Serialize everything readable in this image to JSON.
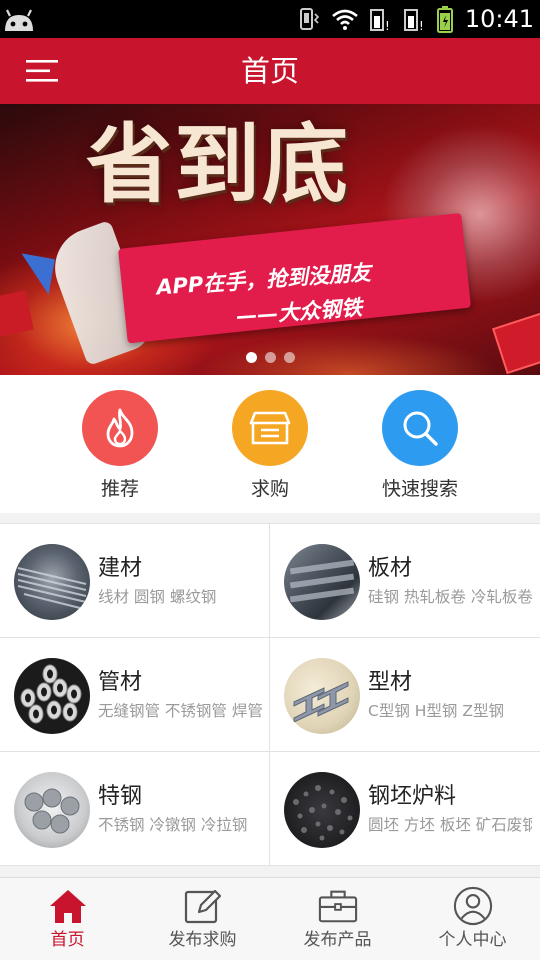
{
  "status_bar": {
    "time": "10:41",
    "icons": [
      "android-icon",
      "vibrate-icon",
      "wifi-icon",
      "signal-icon",
      "signal-icon",
      "battery-icon"
    ]
  },
  "app_bar": {
    "title": "首页",
    "menu_icon": "hamburger-menu-icon"
  },
  "banner": {
    "headline": "省到底",
    "tagline_line1": "APP在手，抢到没朋友",
    "tagline_line2": "——大众钢铁",
    "slide_count": 3,
    "active_slide": 1
  },
  "quick_actions": [
    {
      "label": "推荐",
      "icon": "flame-icon",
      "color": "#f25454"
    },
    {
      "label": "求购",
      "icon": "basket-icon",
      "color": "#f5a623"
    },
    {
      "label": "快速搜索",
      "icon": "search-icon",
      "color": "#2d9cf0"
    }
  ],
  "categories": [
    {
      "title": "建材",
      "subtitle": "线材 圆钢 螺纹钢",
      "thumb": "rebar-bundle-image"
    },
    {
      "title": "板材",
      "subtitle": "硅钢 热轧板卷 冷轧板卷",
      "thumb": "steel-plate-image"
    },
    {
      "title": "管材",
      "subtitle": "无缝钢管 不锈钢管 焊管",
      "thumb": "steel-pipe-image"
    },
    {
      "title": "型材",
      "subtitle": "C型钢 H型钢 Z型钢",
      "thumb": "h-beam-image"
    },
    {
      "title": "特钢",
      "subtitle": "不锈钢 冷镦钢 冷拉钢",
      "thumb": "steel-bar-image"
    },
    {
      "title": "钢坯炉料",
      "subtitle": "圆坯 方坯 板坯 矿石废钢",
      "thumb": "ore-image"
    }
  ],
  "bottom_nav": [
    {
      "label": "首页",
      "icon": "home-icon",
      "active": true
    },
    {
      "label": "发布求购",
      "icon": "edit-icon",
      "active": false
    },
    {
      "label": "发布产品",
      "icon": "briefcase-icon",
      "active": false
    },
    {
      "label": "个人中心",
      "icon": "user-icon",
      "active": false
    }
  ],
  "colors": {
    "brand": "#c8142d",
    "nav_active": "#c8142d",
    "subtitle": "#9a9a9a"
  }
}
